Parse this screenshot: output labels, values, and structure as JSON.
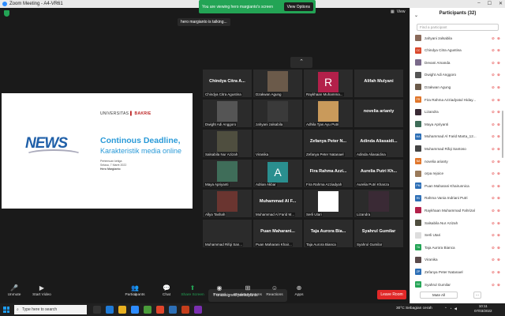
{
  "window": {
    "title": "Zoom Meeting - A4-VR61"
  },
  "banner": {
    "viewing": "You are viewing hero margianto's screen",
    "view_options": "View Options"
  },
  "view_label": "View",
  "talking": "hero margianto is talking...",
  "slide": {
    "university_prefix": "UNIVERSITAS",
    "university_name": "BAKRIE",
    "logo_text": "NEWS",
    "title": "Continous Deadline,",
    "subtitle": "Karakteristik media online",
    "meta_line1": "Pertemuan ketiga",
    "meta_line2": "Selasa, 7 Maret 2022",
    "meta_line3": "Hero Margianto"
  },
  "gallery": [
    {
      "big": "Chindya Citra A...",
      "small": "Chindya Citra Agustina",
      "bg": "#2b2b2b"
    },
    {
      "big": "",
      "small": "Dzakwan Agung",
      "bg": "#6b5a4a"
    },
    {
      "big": "R",
      "small": "Raykhaan Muhamma...",
      "bg": "#b3204a"
    },
    {
      "big": "Alifah Mulyani",
      "small": "",
      "bg": "#2b2b2b"
    },
    {
      "big": "",
      "small": "Dwight Adi Anggoro",
      "bg": "#555"
    },
    {
      "big": "",
      "small": "zahyani zalsabila",
      "bg": "#3a3a3a"
    },
    {
      "big": "",
      "small": "Adhila Tjas Ayu Putri",
      "bg": "#c99a5b"
    },
    {
      "big": "novelia arianty",
      "small": "",
      "bg": "#2b2b2b"
    },
    {
      "big": "",
      "small": "Salsabila Nur Azizah",
      "bg": "#4f4e3f"
    },
    {
      "big": "",
      "small": "Viranika",
      "bg": "#2b2b2b"
    },
    {
      "big": "Zefanya Peter N...",
      "small": "Zefanya Peter Natanael",
      "bg": "#2b2b2b"
    },
    {
      "big": "Adinda Aliasaidi...",
      "small": "Adinda Aliasaidina",
      "bg": "#2b2b2b"
    },
    {
      "big": "",
      "small": "Maya Apriyanti",
      "bg": "#3f6d59"
    },
    {
      "big": "A",
      "small": "Adrian Akbar",
      "bg": "#2a8f8f"
    },
    {
      "big": "Fira Rahma Azzi...",
      "small": "Fira Rahma Azziadyah",
      "bg": "#2b2b2b"
    },
    {
      "big": "Aurelia Putri Kh...",
      "small": "Aurelia Putri Khanza",
      "bg": "#2b2b2b"
    },
    {
      "big": "",
      "small": "Allya Tashah",
      "bg": "#6a3530"
    },
    {
      "big": "Muhammad Al F...",
      "small": "Muhammad Al Farid M...",
      "bg": "#2b2b2b"
    },
    {
      "big": "",
      "small": "Serli Utari",
      "bg": "#ffffff"
    },
    {
      "big": "",
      "small": "Lizandra",
      "bg": "#3a2a35"
    },
    {
      "big": "",
      "small": "Muhammad Rifqi San...",
      "bg": "#2b2b2b"
    },
    {
      "big": "Puan Maharani...",
      "small": "Puan Maharani Khair...",
      "bg": "#2b2b2b"
    },
    {
      "big": "Taja Aurora Bia...",
      "small": "Taja Aurora Bianca",
      "bg": "#2b2b2b"
    },
    {
      "big": "Syahrul Gumilar",
      "small": "Syahrul Gumilar",
      "bg": "#2b2b2b"
    }
  ],
  "unassigned": "7 unassigned participants",
  "toolbar": {
    "unmute": "Unmute",
    "start_video": "Start Video",
    "participants": "Participants",
    "participants_count": "32",
    "chat": "Chat",
    "share_screen": "Share Screen",
    "record": "Record",
    "breakout": "Breakout Rooms",
    "reactions": "Reactions",
    "apps": "Apps",
    "leave": "Leave Room"
  },
  "panel": {
    "title": "Participants (32)",
    "search_placeholder": "Find a participant",
    "mute_all": "Mute All",
    "more": "...",
    "participants": [
      {
        "name": "zahyani zalsabila",
        "initials": "",
        "color": "#8a6a5a"
      },
      {
        "name": "Chindya Citra Agustina",
        "initials": "CC",
        "color": "#d9472b"
      },
      {
        "name": "Devani Amanda",
        "initials": "",
        "color": "#7a6a8a"
      },
      {
        "name": "Dwight Adi Anggoro",
        "initials": "",
        "color": "#555555"
      },
      {
        "name": "Dzakwan Agung",
        "initials": "",
        "color": "#6b5a4a"
      },
      {
        "name": "Fira Rahma Azziadyatul Hiday...",
        "initials": "FR",
        "color": "#e0762b"
      },
      {
        "name": "Lizandra",
        "initials": "",
        "color": "#3a2a35"
      },
      {
        "name": "Maya Apriyanti",
        "initials": "",
        "color": "#3f6d59"
      },
      {
        "name": "Muhammad Al Farid Marta_12...",
        "initials": "MA",
        "color": "#2d6fb6"
      },
      {
        "name": "Muhammad Rifqi Santoso",
        "initials": "",
        "color": "#444444"
      },
      {
        "name": "novelia arianty",
        "initials": "NA",
        "color": "#e0762b"
      },
      {
        "name": "orpa rejoice",
        "initials": "",
        "color": "#9a7a5a"
      },
      {
        "name": "Puan Maharani Khairunnica",
        "initials": "PM",
        "color": "#2d6fb6"
      },
      {
        "name": "Rahma Vania Indriani Putri",
        "initials": "RV",
        "color": "#2d6fb6"
      },
      {
        "name": "Raykhaan Muhammad Fahrizal",
        "initials": "",
        "color": "#b3204a"
      },
      {
        "name": "Salsabila Nur Azizah",
        "initials": "",
        "color": "#4f4e3f"
      },
      {
        "name": "Serli Utari",
        "initials": "",
        "color": "#dddddd"
      },
      {
        "name": "Taja Aurora Bianca",
        "initials": "TA",
        "color": "#23a455"
      },
      {
        "name": "Viranika",
        "initials": "",
        "color": "#5a4a4a"
      },
      {
        "name": "Zefanya Peter Natanael",
        "initials": "ZP",
        "color": "#2d6fb6"
      },
      {
        "name": "Syahrul Gumilar",
        "initials": "SG",
        "color": "#23a455"
      }
    ]
  },
  "taskbar": {
    "search_placeholder": "Type here to search",
    "weather": "30°C Sebagian cerah",
    "time": "10:11",
    "date": "07/03/2022"
  }
}
